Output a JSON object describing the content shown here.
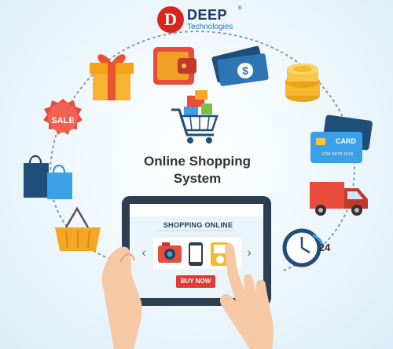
{
  "logo": {
    "initial": "D",
    "name": "DEEP",
    "registered": "®",
    "subtitle": "Technologies"
  },
  "headline": {
    "line1": "Online Shopping",
    "line2": "System"
  },
  "tablet": {
    "heading": "SHOPPING ONLINE",
    "buy_button": "BUY NOW",
    "products": [
      "camera-icon",
      "smartphone-icon",
      "music-player-icon"
    ]
  },
  "badges": {
    "sale": "SALE",
    "card": "CARD",
    "card_number": "1234 5678 1234",
    "support": "24"
  },
  "icons": [
    "gift-icon",
    "wallet-icon",
    "dollar-bills-icon",
    "coins-icon",
    "sale-tag-icon",
    "shopping-bags-icon",
    "basket-icon",
    "shopping-cart-icon",
    "credit-card-icon",
    "delivery-truck-icon",
    "clock-icon",
    "tablet-icon",
    "hands-icon"
  ],
  "colors": {
    "brand_red": "#d9261c",
    "brand_blue": "#16386e",
    "accent_blue": "#1e73be",
    "buy_red": "#e53935",
    "dots": "#8a9aa6"
  }
}
